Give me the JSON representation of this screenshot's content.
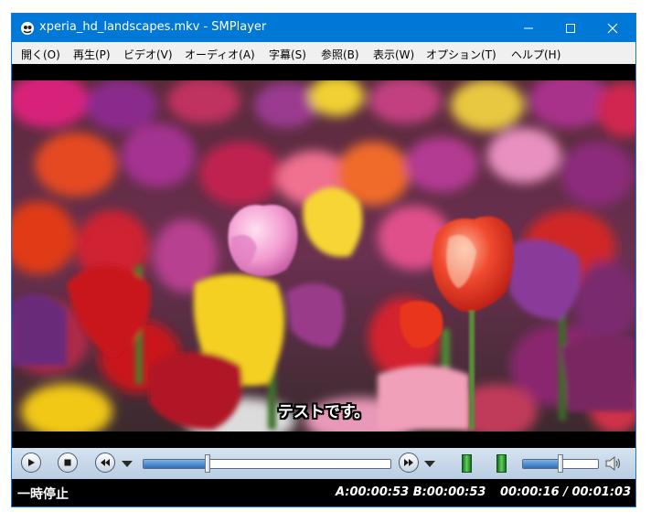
{
  "window": {
    "title": "xperia_hd_landscapes.mkv - SMPlayer"
  },
  "menubar": {
    "items": [
      {
        "label": "開く(O)"
      },
      {
        "label": "再生(P)"
      },
      {
        "label": "ビデオ(V)"
      },
      {
        "label": "オーディオ(A)"
      },
      {
        "label": "字幕(S)"
      },
      {
        "label": "参照(B)"
      },
      {
        "label": "表示(W)"
      },
      {
        "label": "オプション(T)"
      },
      {
        "label": "ヘルプ(H)"
      }
    ]
  },
  "video": {
    "subtitle": "テストです。"
  },
  "controls": {
    "seek_progress_fraction": 0.26,
    "volume_fraction": 0.5,
    "colors": {
      "accent": "#2f6fb7",
      "green_indicator": "#3fb03f"
    }
  },
  "statusbar": {
    "state": "一時停止",
    "ab_markers": "A:00:00:53  B:00:00:53",
    "time": "00:00:16 / 00:01:03"
  },
  "icons": [
    "smplayer-app-icon",
    "minimize-icon",
    "maximize-icon",
    "close-icon",
    "play-icon",
    "stop-icon",
    "rewind-icon",
    "forward-icon",
    "speaker-icon"
  ]
}
